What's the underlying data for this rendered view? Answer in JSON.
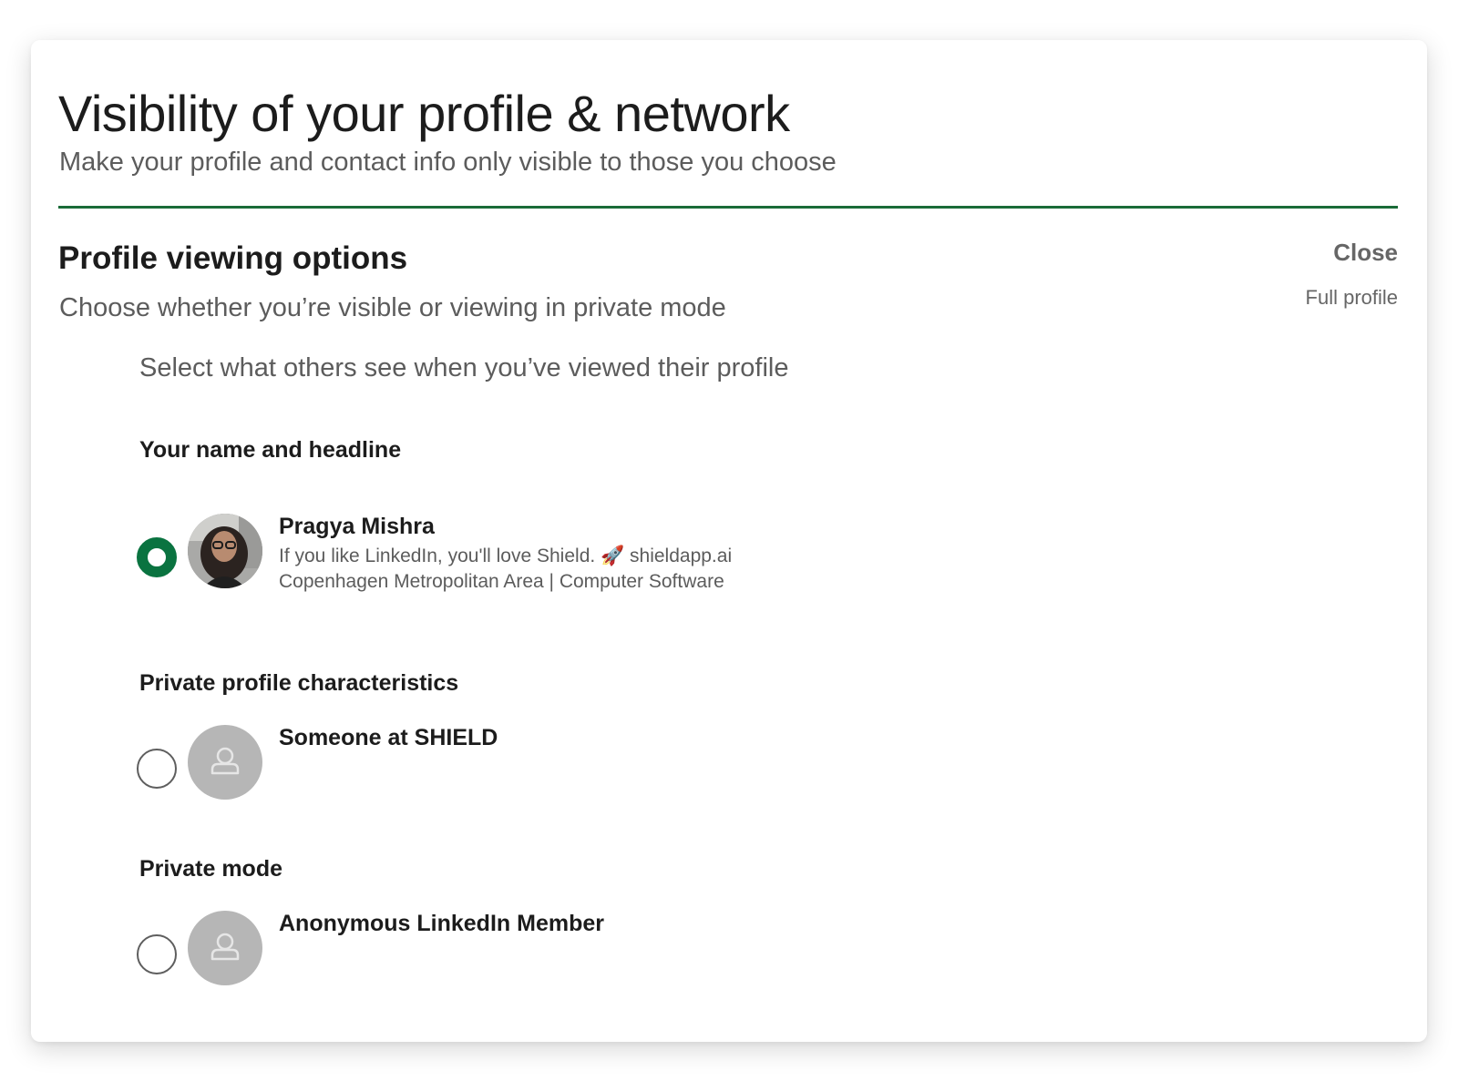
{
  "header": {
    "title": "Visibility of your profile & network",
    "subtitle": "Make your profile and contact info only visible to those you choose"
  },
  "section": {
    "title": "Profile viewing options",
    "description": "Choose whether you’re visible or viewing in private mode",
    "close_label": "Close",
    "current_setting": "Full profile",
    "prompt": "Select what others see when you’ve viewed their profile"
  },
  "options": [
    {
      "group_label": "Your name and headline",
      "name": "Pragya Mishra",
      "headline": "If you like LinkedIn, you'll love Shield. 🚀 shieldapp.ai",
      "details": "Copenhagen Metropolitan Area | Computer Software",
      "selected": true
    },
    {
      "group_label": "Private profile characteristics",
      "name": "Someone at SHIELD",
      "selected": false
    },
    {
      "group_label": "Private mode",
      "name": "Anonymous LinkedIn Member",
      "selected": false
    }
  ],
  "colors": {
    "accent_green": "#0a7340",
    "rule_green": "#1a6b38"
  }
}
